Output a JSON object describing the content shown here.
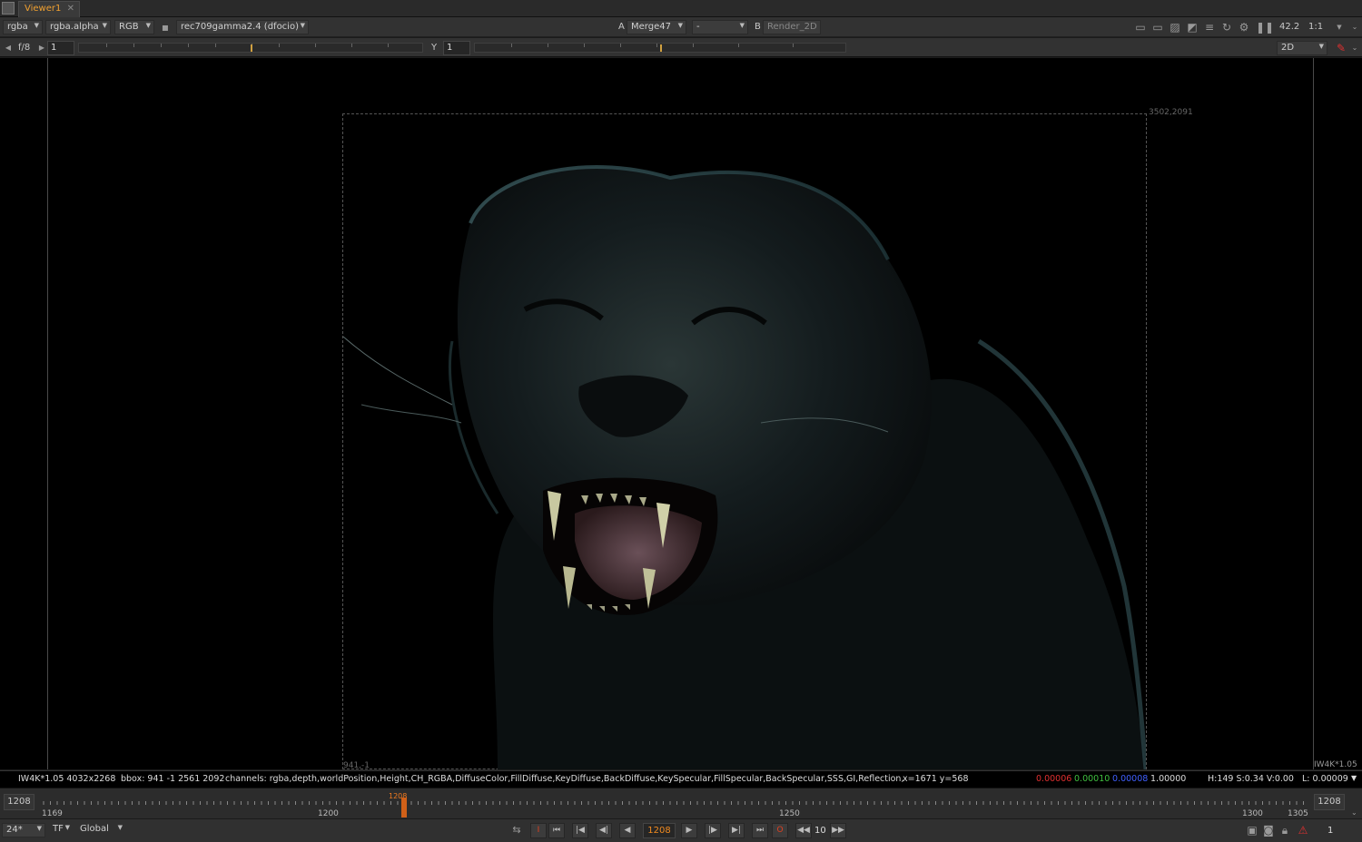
{
  "tab": {
    "label": "Viewer1",
    "close": "✕"
  },
  "toolbar1": {
    "channels": "rgba",
    "alpha": "rgba.alpha",
    "display": "RGB",
    "viewer_process": "rec709gamma2.4 (dfocio)",
    "input_a_label": "A",
    "input_a": "Merge47",
    "blend_mode": "-",
    "input_b_label": "B",
    "input_b": "Render_2D",
    "zoom": "42.2",
    "ratio": "1:1"
  },
  "toolbar2": {
    "fstop": "f/8",
    "gain_value": "1",
    "gamma_label": "Y",
    "gamma_value": "1",
    "view_mode": "2D"
  },
  "viewer": {
    "bbox_top_right": "3502,2091",
    "bbox_bottom_left": "941,-1",
    "format_label": "IW4K*1.05"
  },
  "infobar": {
    "format": "IW4K*1.05 4032x2268",
    "bbox": "bbox: 941 -1 2561 2092",
    "channels": "channels: rgba,depth,worldPosition,Height,CH_RGBA,DiffuseColor,FillDiffuse,KeyDiffuse,BackDiffuse,KeySpecular,FillSpecular,BackSpecular,SSS,GI,Reflection,",
    "position": "x=1671 y=568",
    "r": "0.00006",
    "g": "0.00010",
    "b": "0.00008",
    "a": "1.00000",
    "hsv": "H:149 S:0.34 V:0.00",
    "luma": "L: 0.00009"
  },
  "timeline": {
    "start": "1208",
    "end": "1208",
    "labels": [
      "1169",
      "1200",
      "1250",
      "1300",
      "1305"
    ],
    "current_marker": "1208"
  },
  "bottom": {
    "fps": "24*",
    "tf": "TF",
    "scope": "Global",
    "frame": "1208",
    "increment": "10",
    "right_value": "1"
  },
  "colors": {
    "accent_orange": "#f0a030",
    "red_channel": "#e03030",
    "green_channel": "#40c040",
    "blue_channel": "#4060ff"
  }
}
